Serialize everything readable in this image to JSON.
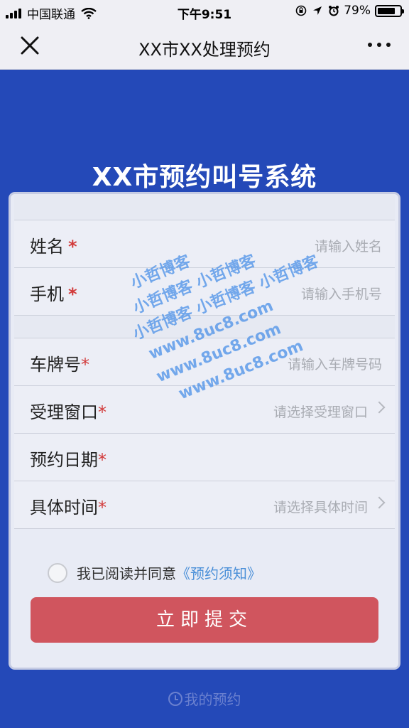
{
  "status_bar": {
    "carrier": "中国联通",
    "time": "下午9:51",
    "battery": "79%",
    "battery_level": 0.79
  },
  "nav": {
    "title": "XX市XX处理预约"
  },
  "page": {
    "heading": "XX市预约叫号系统"
  },
  "form": {
    "name": {
      "label": "姓名",
      "required": "*",
      "placeholder": "请输入姓名"
    },
    "phone": {
      "label": "手机",
      "required": "*",
      "placeholder": "请输入手机号"
    },
    "plate": {
      "label": "车牌号",
      "required": "*",
      "placeholder": "请输入车牌号码"
    },
    "window": {
      "label": "受理窗口",
      "required": "*",
      "placeholder": "请选择受理窗口"
    },
    "date": {
      "label": "预约日期",
      "required": "*",
      "placeholder": ""
    },
    "time": {
      "label": "具体时间",
      "required": "*",
      "placeholder": "请选择具体时间"
    }
  },
  "agreement": {
    "text": "我已阅读并同意",
    "link": "《预约须知》"
  },
  "submit_label": "立即提交",
  "bottom_link": "我的预约",
  "watermark": {
    "lines": [
      "小哲博客",
      "小哲博客 小哲博客",
      "小哲博客 小哲博客 小哲博客",
      "www.8uc8.com",
      "www.8uc8.com",
      "www.8uc8.com"
    ]
  }
}
